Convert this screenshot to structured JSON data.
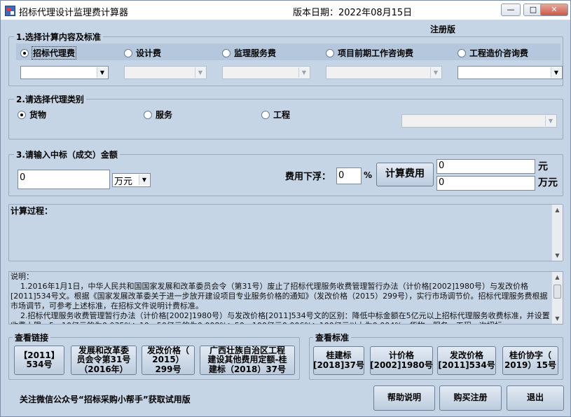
{
  "window": {
    "title": "招标代理设计监理费计算器",
    "version": "版本日期：2022年08月15日",
    "minimize": "—",
    "maximize": "□",
    "close": "✕"
  },
  "edition": "注册版",
  "section1": {
    "legend": "1.选择计算内容及标准",
    "options": [
      {
        "label": "招标代理费",
        "selected": true
      },
      {
        "label": "设计费",
        "selected": false
      },
      {
        "label": "监理服务费",
        "selected": false
      },
      {
        "label": "项目前期工作咨询费",
        "selected": false
      },
      {
        "label": "工程造价咨询费",
        "selected": false
      }
    ],
    "dropdowns": [
      "",
      "",
      "",
      "",
      ""
    ]
  },
  "section2": {
    "legend": "2.请选择代理类别",
    "options": [
      {
        "label": "货物",
        "selected": true
      },
      {
        "label": "服务",
        "selected": false
      },
      {
        "label": "工程",
        "selected": false
      }
    ],
    "dropdown": ""
  },
  "section3": {
    "legend": "3.请输入中标（成交）金额",
    "amount": "0",
    "unit_selected": "万元",
    "discount_label": "费用下浮：",
    "discount_value": "0",
    "percent": "%",
    "calc_button": "计算费用",
    "result_yuan": "0",
    "result_yuan_unit": "元",
    "result_wan": "0",
    "result_wan_unit": "万元"
  },
  "process": {
    "label": "计算过程："
  },
  "notes": {
    "text": "说明：\n    1.2016年1月1日，中华人民共和国国家发展和改革委员会令（第31号）废止了招标代理服务收费管理暂行办法（计价格[2002]1980号）与发改价格[2011]534号文。根据《国家发展改革委关于进一步放开建设项目专业服务价格的通知》（发改价格（2015）299号），实行市场调节价。招标代理服务费根据市场调节，可参考上述标准，在招标文件说明计费标准。\n    2.招标代理服务收费管理暂行办法（计价格[2002]1980号）与发改价格[2011]534号文的区别：降低中标金额在5亿元以上招标代理服务收费标准，并设置收费上限。5－10亿元的为0.035%；10－50亿元的为0.008%；50－100亿元0.006%；100亿元以上为0.004%。货物、服务、工程一次招标"
  },
  "links": {
    "legend": "查看链接",
    "buttons": [
      "【2011】\n534号",
      "发展和改革委\n员会令第31号\n（2016年）",
      "发改价格（\n2015）\n299号",
      "广西壮族自治区工程\n建设其他费用定额-桂\n建标（2018）37号"
    ]
  },
  "standards": {
    "legend": "查看标准",
    "buttons": [
      "桂建标\n[2018]37号",
      "计价格\n[2002]1980号",
      "发改价格\n[2011]534号",
      "桂价协字（\n2019）15号"
    ]
  },
  "footer": {
    "wechat": "关注微信公众号“招标采购小帮手”获取试用版",
    "help": "帮助说明",
    "buy": "购买注册",
    "exit": "退出"
  }
}
